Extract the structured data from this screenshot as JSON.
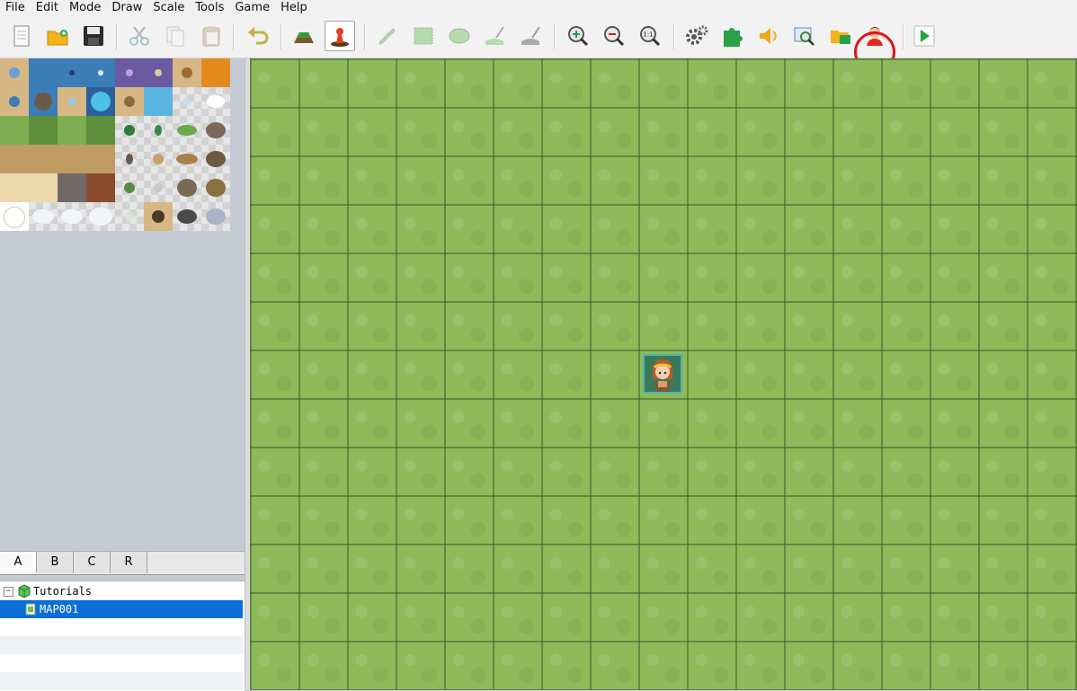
{
  "menu": [
    "File",
    "Edit",
    "Mode",
    "Draw",
    "Scale",
    "Tools",
    "Game",
    "Help"
  ],
  "toolbar": {
    "buttons": [
      {
        "icon": "new-project-icon",
        "state": "enabled"
      },
      {
        "icon": "open-project-icon",
        "state": "enabled"
      },
      {
        "icon": "save-project-icon",
        "state": "enabled"
      },
      {
        "icon": "cut-icon",
        "state": "disabled"
      },
      {
        "icon": "copy-icon",
        "state": "disabled"
      },
      {
        "icon": "paste-icon",
        "state": "disabled"
      },
      {
        "icon": "undo-icon",
        "state": "enabled"
      },
      {
        "icon": "map-mode-icon",
        "state": "enabled"
      },
      {
        "icon": "event-mode-icon",
        "state": "active"
      },
      {
        "icon": "pencil-icon",
        "state": "disabled"
      },
      {
        "icon": "rectangle-icon",
        "state": "disabled"
      },
      {
        "icon": "ellipse-icon",
        "state": "disabled"
      },
      {
        "icon": "flood-fill-icon",
        "state": "disabled"
      },
      {
        "icon": "shadow-pen-icon",
        "state": "disabled"
      },
      {
        "icon": "zoom-in-icon",
        "state": "enabled"
      },
      {
        "icon": "zoom-out-icon",
        "state": "enabled"
      },
      {
        "icon": "actual-size-icon",
        "state": "enabled",
        "label": "1:1"
      },
      {
        "icon": "database-icon",
        "state": "enabled"
      },
      {
        "icon": "plugin-manager-icon",
        "state": "enabled"
      },
      {
        "icon": "sound-test-icon",
        "state": "enabled"
      },
      {
        "icon": "event-searcher-icon",
        "state": "enabled"
      },
      {
        "icon": "resource-manager-icon",
        "state": "enabled"
      },
      {
        "icon": "character-generator-icon",
        "state": "enabled",
        "highlighted": true
      },
      {
        "icon": "playtest-icon",
        "state": "enabled"
      }
    ]
  },
  "tileset_tabs": [
    "A",
    "B",
    "C",
    "R"
  ],
  "active_tab": "A",
  "map_tree": {
    "project": "Tutorials",
    "maps": [
      "MAP001"
    ],
    "selected": "MAP001"
  },
  "colors": {
    "highlight_ring": "#e0141c",
    "selection": "#0a6ed8",
    "grass": "#8fba5a"
  },
  "map": {
    "columns": 17,
    "rows": 13,
    "player_start": {
      "col": 8,
      "row": 6
    }
  }
}
